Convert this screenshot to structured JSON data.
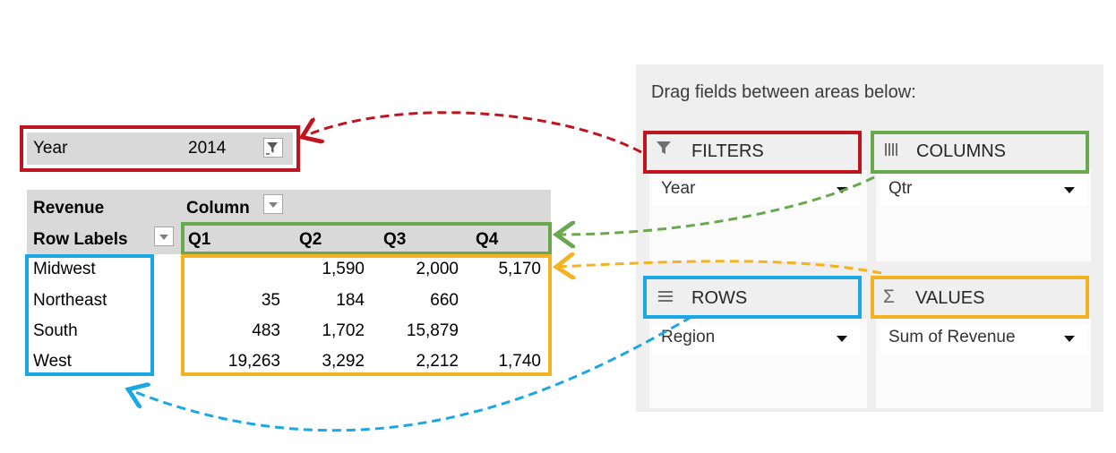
{
  "filter": {
    "field": "Year",
    "value": "2014"
  },
  "pivot": {
    "value_label": "Revenue",
    "column_label": "Column",
    "row_label": "Row Labels",
    "columns": [
      "Q1",
      "Q2",
      "Q3",
      "Q4"
    ],
    "rows": [
      {
        "label": "Midwest",
        "values": [
          "",
          "1,590",
          "2,000",
          "5,170"
        ]
      },
      {
        "label": "Northeast",
        "values": [
          "35",
          "184",
          "660",
          ""
        ]
      },
      {
        "label": "South",
        "values": [
          "483",
          "1,702",
          "15,879",
          ""
        ]
      },
      {
        "label": "West",
        "values": [
          "19,263",
          "3,292",
          "2,212",
          "1,740"
        ]
      }
    ]
  },
  "field_list": {
    "title": "Drag fields between areas below:",
    "areas": {
      "filters": {
        "label": "FILTERS",
        "field": "Year",
        "icon": "filter-icon"
      },
      "columns": {
        "label": "COLUMNS",
        "field": "Qtr",
        "icon": "columns-icon"
      },
      "rows": {
        "label": "ROWS",
        "field": "Region",
        "icon": "rows-icon"
      },
      "values": {
        "label": "VALUES",
        "field": "Sum of Revenue",
        "icon": "sigma-icon"
      }
    }
  },
  "colors": {
    "filters": "#c0141f",
    "columns": "#6aa84f",
    "rows": "#1aa7e3",
    "values": "#f4b223"
  }
}
